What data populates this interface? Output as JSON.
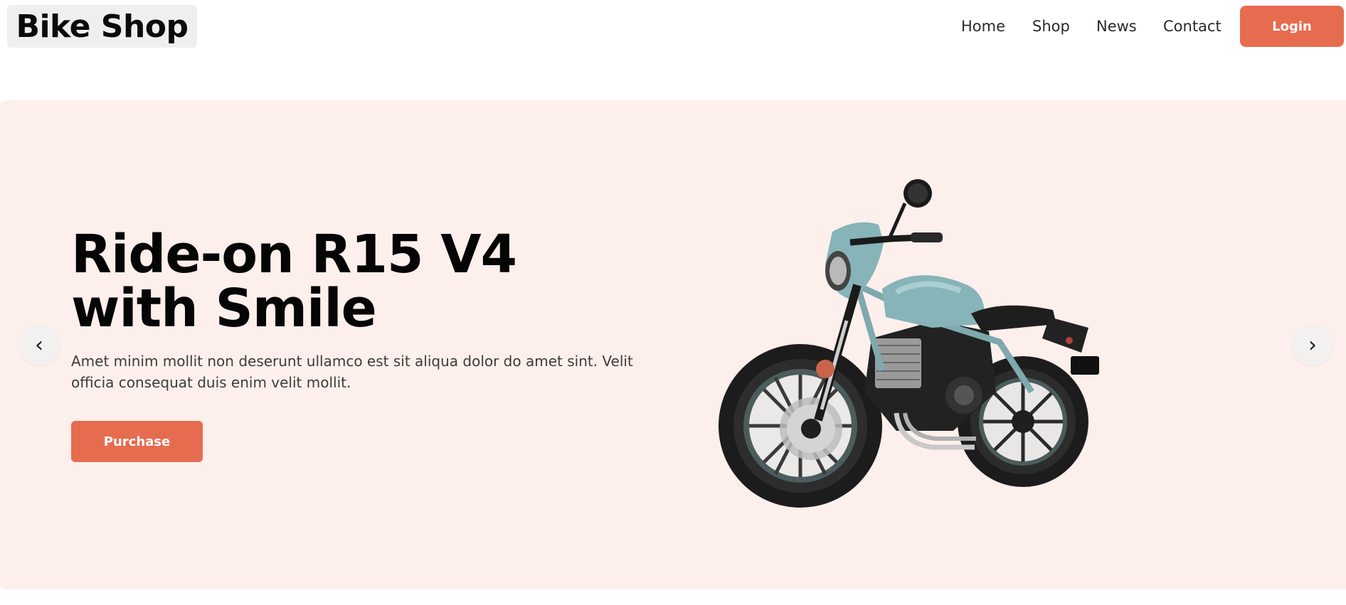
{
  "header": {
    "logo": "Bike Shop",
    "nav": [
      {
        "label": "Home"
      },
      {
        "label": "Shop"
      },
      {
        "label": "News"
      },
      {
        "label": "Contact"
      }
    ],
    "login_label": "Login"
  },
  "hero": {
    "title_line1": "Ride-on R15 V4",
    "title_line2": "with Smile",
    "description": "Amet minim mollit non deserunt ullamco est sit aliqua dolor do amet sint. Velit officia consequat duis enim velit mollit.",
    "purchase_label": "Purchase",
    "prev_arrow": "‹",
    "next_arrow": "›",
    "image": "motorcycle-image"
  },
  "colors": {
    "accent": "#e66c4f",
    "hero_bg": "#fdefeb",
    "logo_bg": "#efefef",
    "text_dark": "#050505",
    "bike_teal": "#86b4b8"
  }
}
